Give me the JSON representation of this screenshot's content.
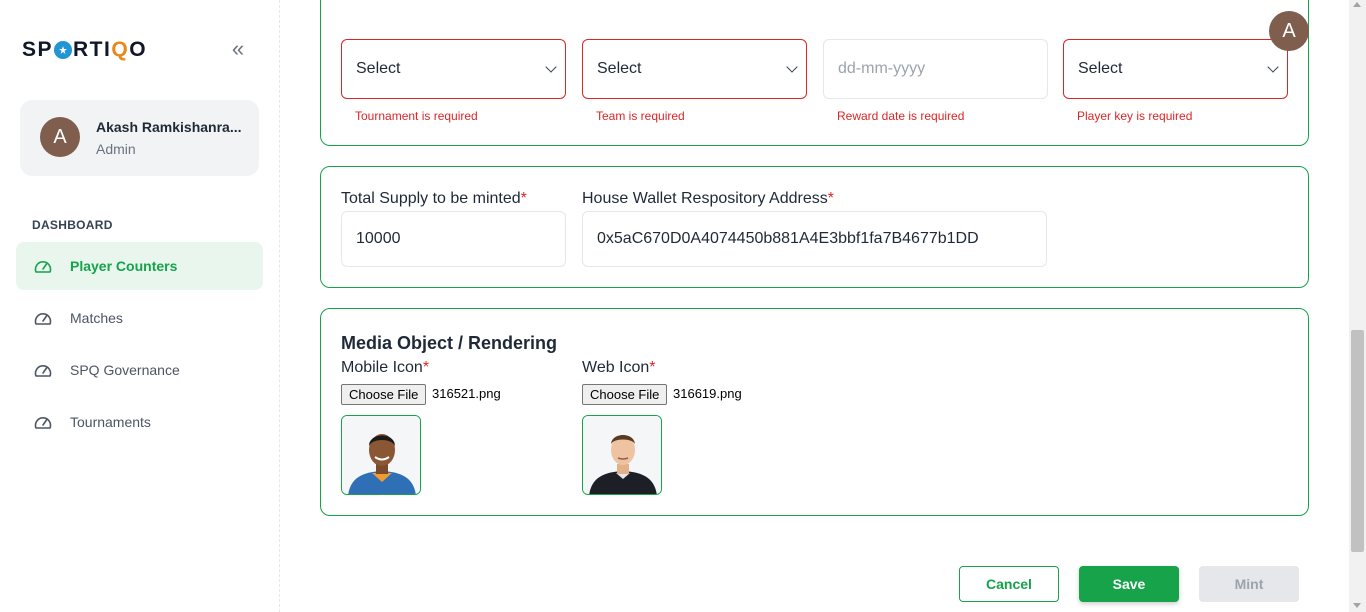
{
  "app": {
    "logo_text_a": "SP",
    "logo_text_b": "RTI",
    "logo_text_q": "Q",
    "logo_text_c": "O",
    "collapse_icon": "«"
  },
  "user": {
    "initial": "A",
    "name": "Akash Ramkishanra...",
    "role": "Admin"
  },
  "nav": {
    "heading": "DASHBOARD",
    "items": [
      {
        "label": "Player Counters",
        "active": true
      },
      {
        "label": "Matches",
        "active": false
      },
      {
        "label": "SPQ Governance",
        "active": false
      },
      {
        "label": "Tournaments",
        "active": false
      }
    ]
  },
  "header": {
    "avatar_initial": "A"
  },
  "selection_panel": {
    "fields": [
      {
        "value": "Select",
        "error": "Tournament is required"
      },
      {
        "value": "Select",
        "error": "Team is required"
      },
      {
        "placeholder": "dd-mm-yyyy",
        "error": "Reward date is required"
      },
      {
        "value": "Select",
        "error": "Player key is required"
      }
    ]
  },
  "supply_panel": {
    "total_supply_label": "Total Supply to be minted",
    "total_supply_value": "10000",
    "wallet_label": "House Wallet Respository Address",
    "wallet_value": "0x5aC670D0A4074450b881A4E3bbf1fa7B4677b1DD",
    "required_mark": "*"
  },
  "media_panel": {
    "title": "Media Object / Rendering",
    "mobile_icon_label": "Mobile Icon",
    "mobile_file_button": "Choose File",
    "mobile_file_name": "316521.png",
    "web_icon_label": "Web Icon",
    "web_file_button": "Choose File",
    "web_file_name": "316619.png"
  },
  "actions": {
    "cancel": "Cancel",
    "save": "Save",
    "mint": "Mint"
  },
  "colors": {
    "accent": "#16a34a",
    "error": "#dc2626",
    "avatar": "#7f5e4e"
  }
}
